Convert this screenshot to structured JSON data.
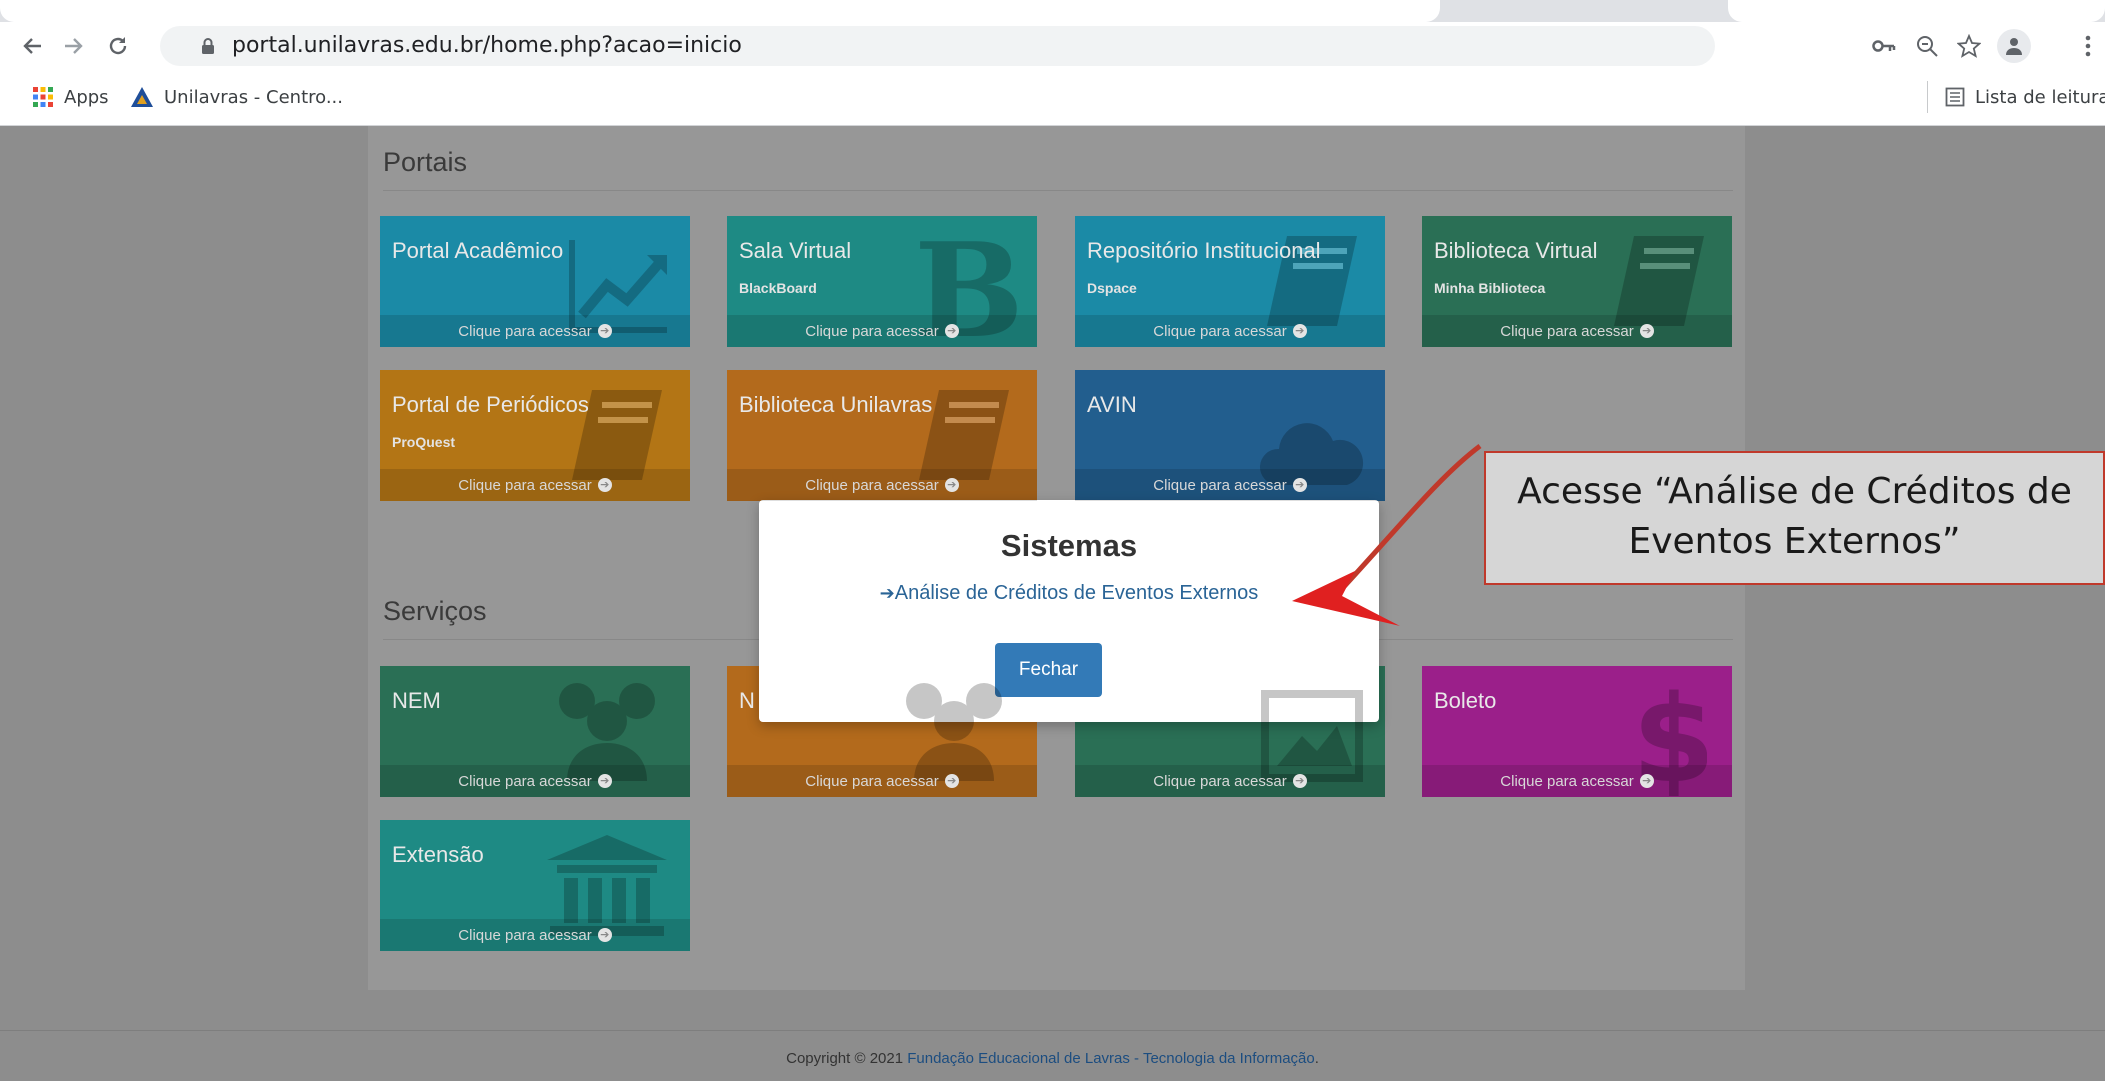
{
  "browser": {
    "url": "portal.unilavras.edu.br/home.php?acao=inicio",
    "bookmarks": [
      {
        "label": "Apps",
        "icon": "apps-grid-icon"
      },
      {
        "label": "Unilavras - Centro...",
        "icon": "unilavras-logo-icon"
      }
    ],
    "reading_list": "Lista de leitura"
  },
  "portais": {
    "title": "Portais",
    "tiles": [
      {
        "title": "Portal Acadêmico",
        "subtitle": "",
        "footer": "Clique para acessar",
        "color": "#1b8aa6",
        "icon": "chart-line-icon"
      },
      {
        "title": "Sala Virtual",
        "subtitle": "BlackBoard",
        "footer": "Clique para acessar",
        "color": "#1e8a84",
        "icon": "blackboard-b-icon"
      },
      {
        "title": "Repositório Institucional",
        "subtitle": "Dspace",
        "footer": "Clique para acessar",
        "color": "#1b8aa6",
        "icon": "book-icon"
      },
      {
        "title": "Biblioteca Virtual",
        "subtitle": "Minha Biblioteca",
        "footer": "Clique para acessar",
        "color": "#2a6f55",
        "icon": "book-icon"
      },
      {
        "title": "Portal de Periódicos",
        "subtitle": "ProQuest",
        "footer": "Clique para acessar",
        "color": "#b37515",
        "icon": "book-icon"
      },
      {
        "title": "Biblioteca Unilavras",
        "subtitle": "",
        "footer": "Clique para acessar",
        "color": "#b36a1c",
        "icon": "book-icon"
      },
      {
        "title": "AVIN",
        "subtitle": "",
        "footer": "Clique para acessar",
        "color": "#225e8e",
        "icon": "cloud-icon"
      }
    ]
  },
  "servicos": {
    "title": "Serviços",
    "tiles": [
      {
        "title": "NEM",
        "subtitle": "",
        "footer": "Clique para acessar",
        "color": "#2a6f55",
        "icon": "users-icon"
      },
      {
        "title": "N",
        "subtitle": "",
        "footer": "Clique para acessar",
        "color": "#b36a1c",
        "icon": "users-icon"
      },
      {
        "title": "",
        "subtitle": "",
        "footer": "Clique para acessar",
        "color": "#2a6f55",
        "icon": "image-icon"
      },
      {
        "title": "Boleto",
        "subtitle": "",
        "footer": "Clique para acessar",
        "color": "#9b1f8a",
        "icon": "dollar-icon"
      },
      {
        "title": "Extensão",
        "subtitle": "",
        "footer": "Clique para acessar",
        "color": "#1e8a84",
        "icon": "institution-icon"
      }
    ]
  },
  "modal": {
    "title": "Sistemas",
    "link": "Análise de Créditos de Eventos Externos",
    "close_label": "Fechar"
  },
  "callout": {
    "line1": "Acesse “Análise de Créditos de",
    "line2": "Eventos Externos”",
    "border_color": "#c0392b"
  },
  "footer": {
    "prefix": "Copyright © 2021 ",
    "link": "Fundação Educacional de Lavras - Tecnologia da Informação",
    "suffix": "."
  }
}
